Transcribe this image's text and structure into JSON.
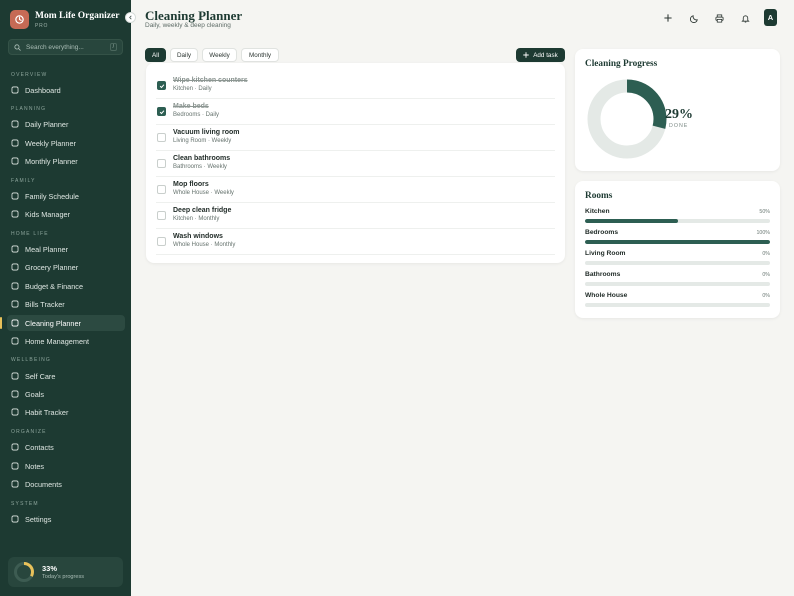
{
  "app": {
    "name": "Mom Life Organizer",
    "plan": "PRO"
  },
  "search": {
    "placeholder": "Search everything...",
    "shortcut": "/"
  },
  "sidebar": {
    "sections": [
      {
        "label": "OVERVIEW",
        "items": [
          {
            "label": "Dashboard",
            "icon": "home-icon"
          }
        ]
      },
      {
        "label": "PLANNING",
        "items": [
          {
            "label": "Daily Planner",
            "icon": "calendar-icon"
          },
          {
            "label": "Weekly Planner",
            "icon": "calendar-week-icon"
          },
          {
            "label": "Monthly Planner",
            "icon": "calendar-month-icon"
          }
        ]
      },
      {
        "label": "FAMILY",
        "items": [
          {
            "label": "Family Schedule",
            "icon": "clock-icon"
          },
          {
            "label": "Kids Manager",
            "icon": "kids-icon"
          }
        ]
      },
      {
        "label": "HOME LIFE",
        "items": [
          {
            "label": "Meal Planner",
            "icon": "utensils-icon"
          },
          {
            "label": "Grocery Planner",
            "icon": "cart-icon"
          },
          {
            "label": "Budget & Finance",
            "icon": "wallet-icon"
          },
          {
            "label": "Bills Tracker",
            "icon": "receipt-icon"
          },
          {
            "label": "Cleaning Planner",
            "icon": "sparkle-icon",
            "active": true
          },
          {
            "label": "Home Management",
            "icon": "house-icon"
          }
        ]
      },
      {
        "label": "WELLBEING",
        "items": [
          {
            "label": "Self Care",
            "icon": "heart-icon"
          },
          {
            "label": "Goals",
            "icon": "target-icon"
          },
          {
            "label": "Habit Tracker",
            "icon": "check-circle-icon"
          }
        ]
      },
      {
        "label": "ORGANIZE",
        "items": [
          {
            "label": "Contacts",
            "icon": "contacts-icon"
          },
          {
            "label": "Notes",
            "icon": "note-icon"
          },
          {
            "label": "Documents",
            "icon": "document-icon"
          }
        ]
      },
      {
        "label": "SYSTEM",
        "items": [
          {
            "label": "Settings",
            "icon": "gear-icon"
          }
        ]
      }
    ],
    "progress": {
      "value": "33%",
      "label": "Today's progress",
      "fraction": 0.33
    }
  },
  "header": {
    "title": "Cleaning Planner",
    "subtitle": "Daily, weekly & deep cleaning",
    "avatar_initial": "A"
  },
  "filters": {
    "tabs": [
      {
        "label": "All",
        "active": true
      },
      {
        "label": "Daily"
      },
      {
        "label": "Weekly"
      },
      {
        "label": "Monthly"
      }
    ],
    "add_label": "Add task"
  },
  "tasks": [
    {
      "title": "Wipe kitchen counters",
      "meta": "Kitchen · Daily",
      "done": true
    },
    {
      "title": "Make beds",
      "meta": "Bedrooms · Daily",
      "done": true
    },
    {
      "title": "Vacuum living room",
      "meta": "Living Room · Weekly",
      "done": false
    },
    {
      "title": "Clean bathrooms",
      "meta": "Bathrooms · Weekly",
      "done": false
    },
    {
      "title": "Mop floors",
      "meta": "Whole House · Weekly",
      "done": false
    },
    {
      "title": "Deep clean fridge",
      "meta": "Kitchen · Monthly",
      "done": false
    },
    {
      "title": "Wash windows",
      "meta": "Whole House · Monthly",
      "done": false
    }
  ],
  "progress": {
    "title": "Cleaning Progress",
    "value": "29%",
    "label": "DONE",
    "fraction": 0.29
  },
  "rooms": {
    "title": "Rooms",
    "items": [
      {
        "name": "Kitchen",
        "value": "50%",
        "fraction": 0.5
      },
      {
        "name": "Bedrooms",
        "value": "100%",
        "fraction": 1.0
      },
      {
        "name": "Living Room",
        "value": "0%",
        "fraction": 0
      },
      {
        "name": "Bathrooms",
        "value": "0%",
        "fraction": 0
      },
      {
        "name": "Whole House",
        "value": "0%",
        "fraction": 0
      }
    ]
  },
  "colors": {
    "sidebar": "#1d3a32",
    "accent": "#2d5e52",
    "brand": "#c66a55",
    "highlight": "#e8c15a",
    "track": "#e4e9e6"
  }
}
